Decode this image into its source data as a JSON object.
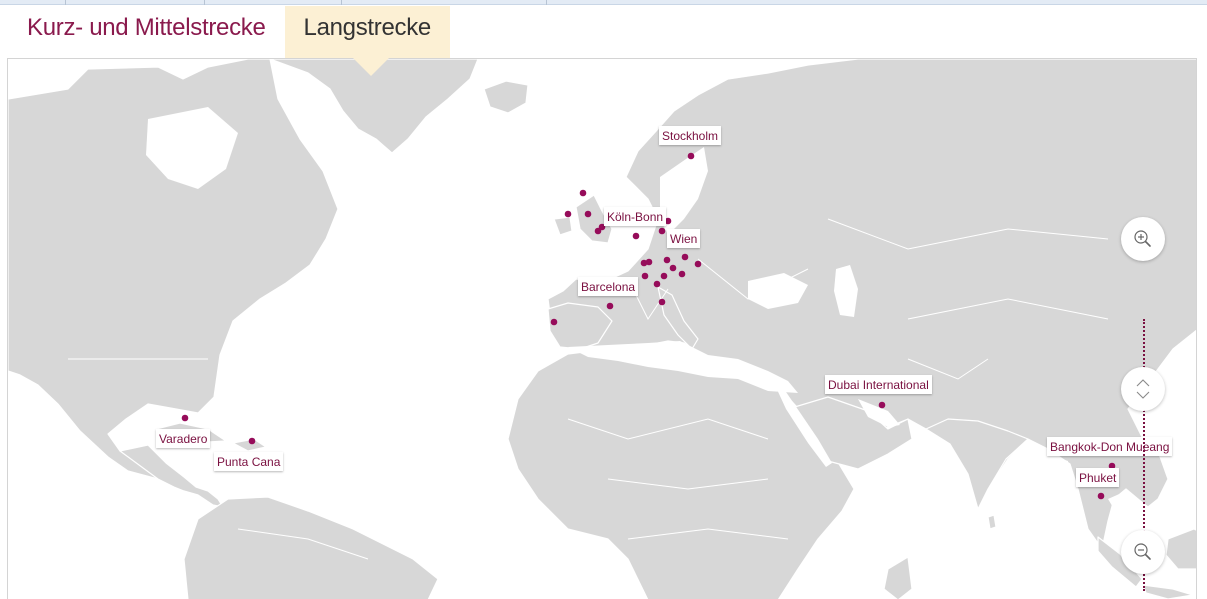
{
  "tabs": [
    {
      "label": "Kurz- und Mittelstrecke",
      "active": false
    },
    {
      "label": "Langstrecke",
      "active": true
    }
  ],
  "accent_color": "#8a1a4d",
  "dot_color": "#960c5a",
  "land_color": "#d7d7d7",
  "active_tab_color": "#fcf0d4",
  "map": {
    "labeled_cities": [
      {
        "label": "Stockholm"
      },
      {
        "label": "Köln-Bonn"
      },
      {
        "label": "Wien"
      },
      {
        "label": "Barcelona"
      },
      {
        "label": "Dubai International"
      },
      {
        "label": "Varadero"
      },
      {
        "label": "Punta Cana"
      },
      {
        "label": "Bangkok-Don Mueang"
      },
      {
        "label": "Phuket"
      }
    ],
    "controls": {
      "zoom_in_icon": "zoom-in-icon",
      "pan_icon": "pan-up-down-icon",
      "zoom_out_icon": "zoom-out-icon"
    }
  }
}
